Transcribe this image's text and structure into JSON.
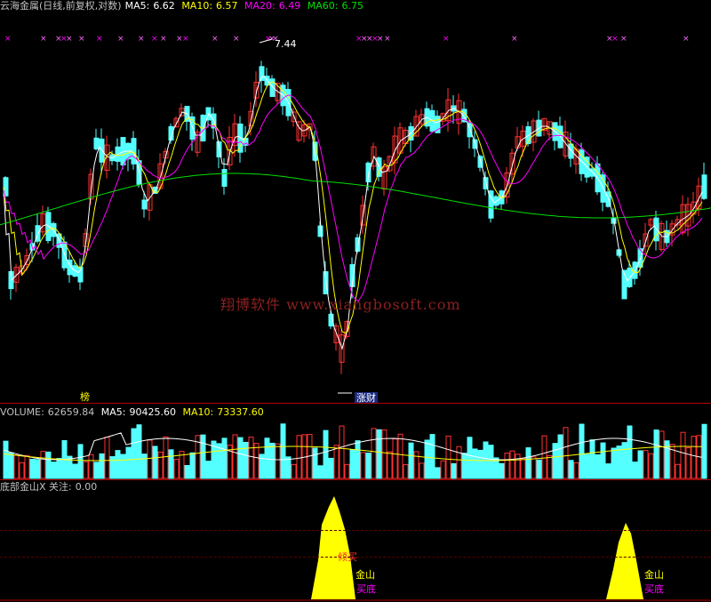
{
  "main_header": {
    "title": "云海金属(日线,前复权,对数)",
    "ma5_label": "MA5:",
    "ma5_value": "6.62",
    "ma10_label": "MA10:",
    "ma10_value": "6.57",
    "ma20_label": "MA20:",
    "ma20_value": "6.49",
    "ma60_label": "MA60:",
    "ma60_value": "6.75"
  },
  "annotations": {
    "high_price": "7.44",
    "marker_bang": "榜",
    "marker_zhangcai": "涨财"
  },
  "watermark": "翔博软件 www.xiangbosoft.com",
  "volume_header": {
    "label": "VOLUME:",
    "value": "62659.84",
    "ma5_label": "MA5:",
    "ma5_value": "90425.60",
    "ma10_label": "MA10:",
    "ma10_value": "73337.60"
  },
  "indicator_header": {
    "label": "底部金山X 关注:",
    "value": "0.00"
  },
  "indicator_labels": {
    "signal1_top": "倾买",
    "signal1_mid": "金山",
    "signal1_bot": "买底",
    "signal2_mid": "金山",
    "signal2_bot": "买底"
  },
  "colors": {
    "up": "#ff3232",
    "down": "#54ffff",
    "ma5": "#ffffff",
    "ma10": "#ffff00",
    "ma20": "#ff00ff",
    "ma60": "#00e000",
    "signal": "#ffff00"
  },
  "chart_data": [
    {
      "type": "candlestick",
      "title": "云海金属(日线,前复权,对数)",
      "series_ma": [
        {
          "name": "MA5",
          "last": 6.62
        },
        {
          "name": "MA10",
          "last": 6.57
        },
        {
          "name": "MA20",
          "last": 6.49
        },
        {
          "name": "MA60",
          "last": 6.75
        }
      ],
      "annotated_high": 7.44
    },
    {
      "type": "bar",
      "title": "VOLUME",
      "last": 62659.84,
      "series_ma": [
        {
          "name": "MA5",
          "last": 90425.6
        },
        {
          "name": "MA10",
          "last": 73337.6
        }
      ]
    },
    {
      "type": "area",
      "title": "底部金山X",
      "last": 0.0
    }
  ]
}
